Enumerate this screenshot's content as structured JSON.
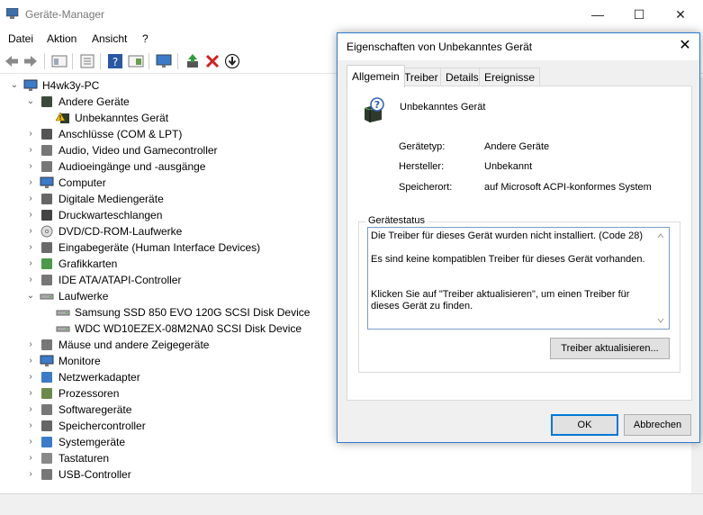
{
  "main_window": {
    "title": "Geräte-Manager",
    "controls": {
      "minimize": "—",
      "maximize": "☐",
      "close": "✕"
    }
  },
  "menu": [
    "Datei",
    "Aktion",
    "Ansicht",
    "?"
  ],
  "toolbar_icons": [
    "back-icon",
    "forward-icon",
    "properties-icon",
    "list-icon",
    "help-icon",
    "view-icon",
    "monitor-scan-icon",
    "update-driver-icon",
    "uninstall-icon",
    "download-icon"
  ],
  "tree": {
    "root": "H4wk3y-PC",
    "items": [
      {
        "label": "Andere Geräte",
        "level": 1,
        "expanded": true,
        "icon": "unknown-device-icon"
      },
      {
        "label": "Unbekanntes Gerät",
        "level": 2,
        "icon": "warning-device-icon"
      },
      {
        "label": "Anschlüsse (COM & LPT)",
        "level": 1,
        "icon": "port-icon"
      },
      {
        "label": "Audio, Video und Gamecontroller",
        "level": 1,
        "icon": "speaker-icon"
      },
      {
        "label": "Audioeingänge und -ausgänge",
        "level": 1,
        "icon": "speaker-icon"
      },
      {
        "label": "Computer",
        "level": 1,
        "icon": "computer-icon"
      },
      {
        "label": "Digitale Mediengeräte",
        "level": 1,
        "icon": "media-device-icon"
      },
      {
        "label": "Druckwarteschlangen",
        "level": 1,
        "icon": "printer-icon"
      },
      {
        "label": "DVD/CD-ROM-Laufwerke",
        "level": 1,
        "icon": "disc-icon"
      },
      {
        "label": "Eingabegeräte (Human Interface Devices)",
        "level": 1,
        "icon": "hid-icon"
      },
      {
        "label": "Grafikkarten",
        "level": 1,
        "icon": "graphics-card-icon"
      },
      {
        "label": "IDE ATA/ATAPI-Controller",
        "level": 1,
        "icon": "controller-icon"
      },
      {
        "label": "Laufwerke",
        "level": 1,
        "expanded": true,
        "icon": "drive-icon"
      },
      {
        "label": "Samsung SSD 850 EVO 120G SCSI Disk Device",
        "level": 2,
        "icon": "drive-icon"
      },
      {
        "label": "WDC WD10EZEX-08M2NA0 SCSI Disk Device",
        "level": 2,
        "icon": "drive-icon"
      },
      {
        "label": "Mäuse und andere Zeigegeräte",
        "level": 1,
        "icon": "mouse-icon"
      },
      {
        "label": "Monitore",
        "level": 1,
        "icon": "monitor-icon"
      },
      {
        "label": "Netzwerkadapter",
        "level": 1,
        "icon": "network-icon"
      },
      {
        "label": "Prozessoren",
        "level": 1,
        "icon": "cpu-icon"
      },
      {
        "label": "Softwaregeräte",
        "level": 1,
        "icon": "software-device-icon"
      },
      {
        "label": "Speichercontroller",
        "level": 1,
        "icon": "storage-controller-icon"
      },
      {
        "label": "Systemgeräte",
        "level": 1,
        "icon": "system-device-icon"
      },
      {
        "label": "Tastaturen",
        "level": 1,
        "icon": "keyboard-icon"
      },
      {
        "label": "USB-Controller",
        "level": 1,
        "icon": "usb-icon"
      }
    ]
  },
  "dialog": {
    "title": "Eigenschaften von Unbekanntes Gerät",
    "close": "✕",
    "tabs": [
      "Allgemein",
      "Treiber",
      "Details",
      "Ereignisse"
    ],
    "active_tab": "Allgemein",
    "device_name": "Unbekanntes Gerät",
    "props": [
      {
        "label": "Gerätetyp:",
        "value": "Andere Geräte"
      },
      {
        "label": "Hersteller:",
        "value": "Unbekannt"
      },
      {
        "label": "Speicherort:",
        "value": "auf Microsoft ACPI-konformes System"
      }
    ],
    "status_legend": "Gerätestatus",
    "status_lines": [
      "Die Treiber für dieses Gerät wurden nicht installiert. (Code 28)",
      "Es sind keine kompatiblen Treiber für dieses Gerät vorhanden.",
      "Klicken Sie auf \"Treiber aktualisieren\", um einen Treiber für dieses Gerät zu finden."
    ],
    "update_button": "Treiber aktualisieren...",
    "ok_button": "OK",
    "cancel_button": "Abbrechen"
  },
  "colors": {
    "accent": "#0078d7",
    "dialog_border": "#2b7bd0",
    "warning": "#f2c200",
    "uninstall": "#d32020"
  }
}
